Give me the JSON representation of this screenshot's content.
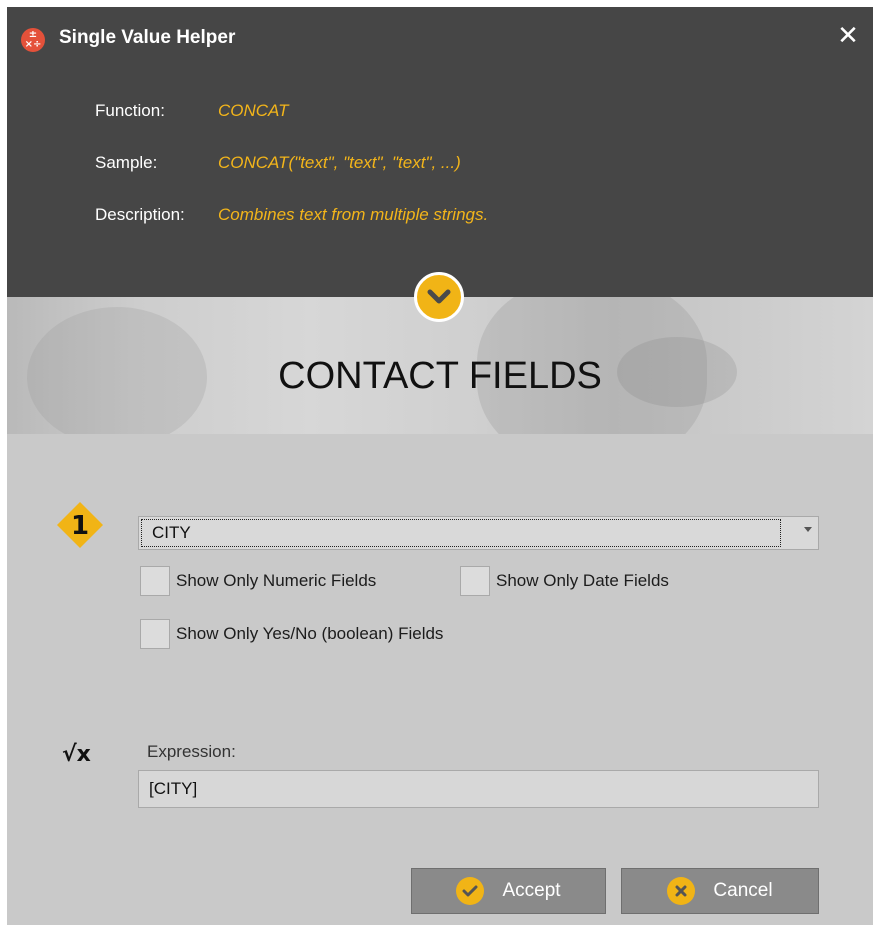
{
  "window": {
    "title": "Single Value Helper",
    "close_symbol": "✕"
  },
  "info": {
    "function_label": "Function:",
    "function_value": "CONCAT",
    "sample_label": "Sample:",
    "sample_value": "CONCAT(\"text\", \"text\", \"text\", ...)",
    "description_label": "Description:",
    "description_value": "Combines text from multiple strings."
  },
  "banner": {
    "title": "CONTACT FIELDS"
  },
  "field_picker": {
    "step_number": "1",
    "selected_value": "CITY",
    "checkboxes": {
      "numeric": {
        "label": "Show Only Numeric Fields",
        "checked": false
      },
      "date": {
        "label": "Show Only Date Fields",
        "checked": false
      },
      "boolean": {
        "label": "Show Only Yes/No (boolean) Fields",
        "checked": false
      }
    }
  },
  "expression": {
    "icon_text": "√x",
    "label": "Expression:",
    "value": "[CITY]"
  },
  "buttons": {
    "accept": "Accept",
    "cancel": "Cancel"
  },
  "colors": {
    "accent": "#f1b416",
    "header_bg": "#464646",
    "body_bg": "#c9c9c9",
    "button_bg": "#8a8a8a",
    "app_icon": "#e4513a"
  },
  "icons": {
    "app": "calculator-icon",
    "close": "close-icon",
    "chevron": "chevron-down-icon",
    "step": "step-number-badge",
    "expression": "square-root-icon",
    "accept": "check-circle-icon",
    "cancel": "x-circle-icon"
  }
}
